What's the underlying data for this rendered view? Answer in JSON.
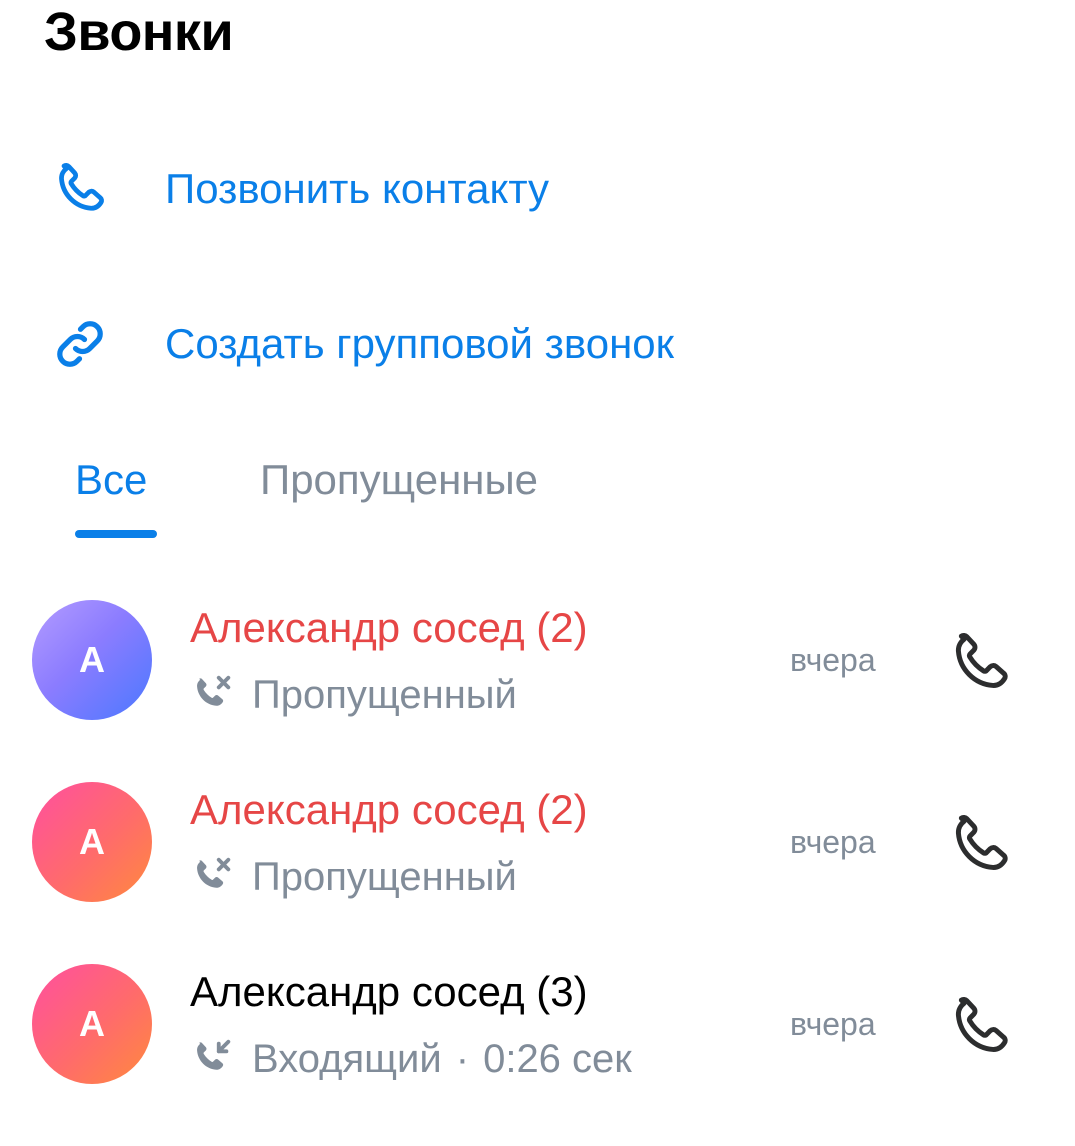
{
  "header": {
    "title": "Звонки"
  },
  "actions": [
    {
      "label": "Позвонить контакту",
      "icon": "phone-icon"
    },
    {
      "label": "Создать групповой звонок",
      "icon": "link-icon"
    }
  ],
  "tabs": [
    {
      "label": "Все",
      "active": true
    },
    {
      "label": "Пропущенные",
      "active": false
    }
  ],
  "calls": [
    {
      "avatar_letter": "А",
      "name": "Александр сосед (2)",
      "status": "Пропущенный",
      "type": "missed",
      "duration": "",
      "time": "вчера"
    },
    {
      "avatar_letter": "А",
      "name": "Александр сосед (2)",
      "status": "Пропущенный",
      "type": "missed",
      "duration": "",
      "time": "вчера"
    },
    {
      "avatar_letter": "А",
      "name": "Александр сосед (3)",
      "status": "Входящий",
      "type": "incoming",
      "duration": "0:26 сек",
      "time": "вчера"
    }
  ],
  "colors": {
    "accent": "#0a7fe8",
    "missed": "#e64646",
    "secondary": "#818c99"
  }
}
